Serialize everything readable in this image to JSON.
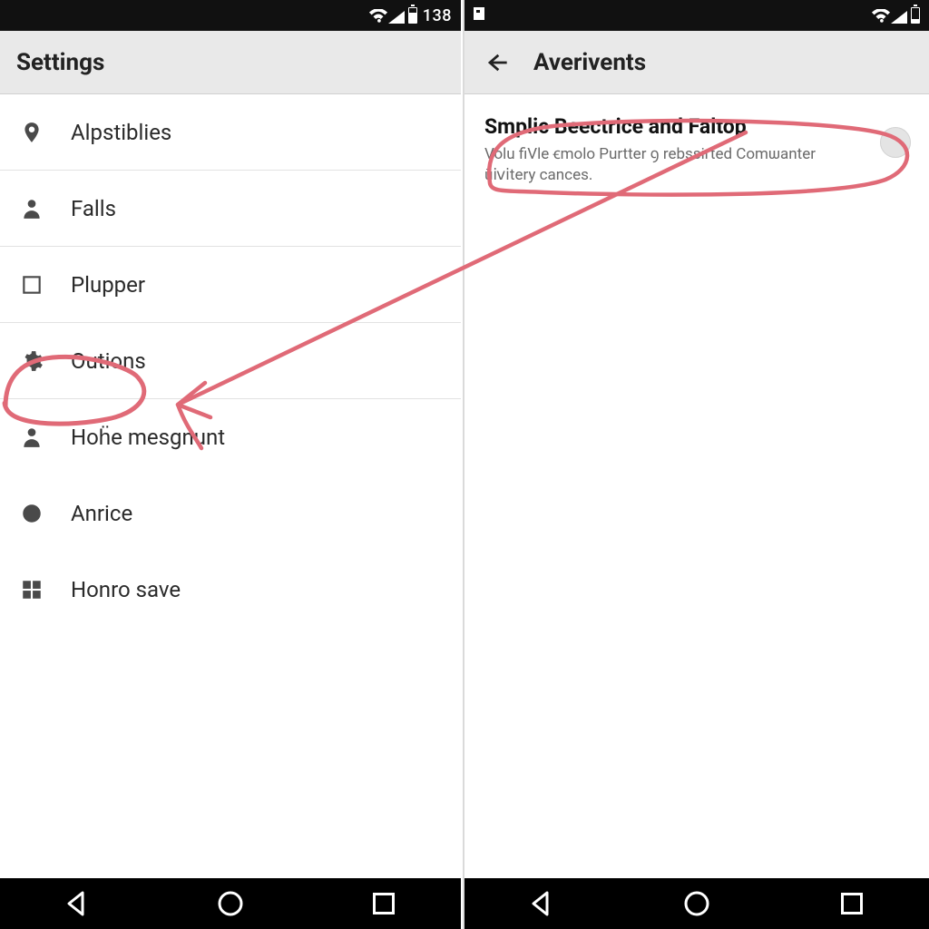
{
  "left": {
    "status": {
      "time": "138"
    },
    "appbar": {
      "title": "Settings"
    },
    "items": [
      {
        "icon": "pin",
        "label": "Alpstiblies"
      },
      {
        "icon": "person",
        "label": "Falls"
      },
      {
        "icon": "square",
        "label": "Plupper"
      },
      {
        "icon": "gear",
        "label": "Outions"
      },
      {
        "icon": "person",
        "label": "Hoḧe mesgnunt"
      },
      {
        "icon": "circle",
        "label": "Anrice"
      },
      {
        "icon": "grid",
        "label": "Honro save"
      }
    ]
  },
  "right": {
    "appbar": {
      "title": "Averivents"
    },
    "setting": {
      "title": "Smplic Beectrice and Faltop",
      "subtitle": "Volu fiVle ꞓmolo Purtter ꝯ rebssirted Comѡanter ūⅳⅰtery cances."
    }
  },
  "annotation": {
    "color": "#e06a77"
  }
}
